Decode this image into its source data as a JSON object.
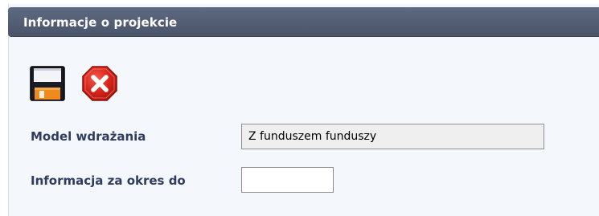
{
  "panel": {
    "title": "Informacje o projekcie"
  },
  "toolbar": {
    "save_icon": "floppy-disk-icon",
    "cancel_icon": "red-octagon-x-icon"
  },
  "form": {
    "model_label": "Model wdrażania",
    "model_value": "Z funduszem funduszy",
    "period_label": "Informacja za okres do",
    "period_value": ""
  },
  "colors": {
    "header_bg": "#535e74",
    "panel_bg": "#f4f8fc",
    "label_text": "#2f3c5f",
    "cancel_red": "#d8261c"
  }
}
